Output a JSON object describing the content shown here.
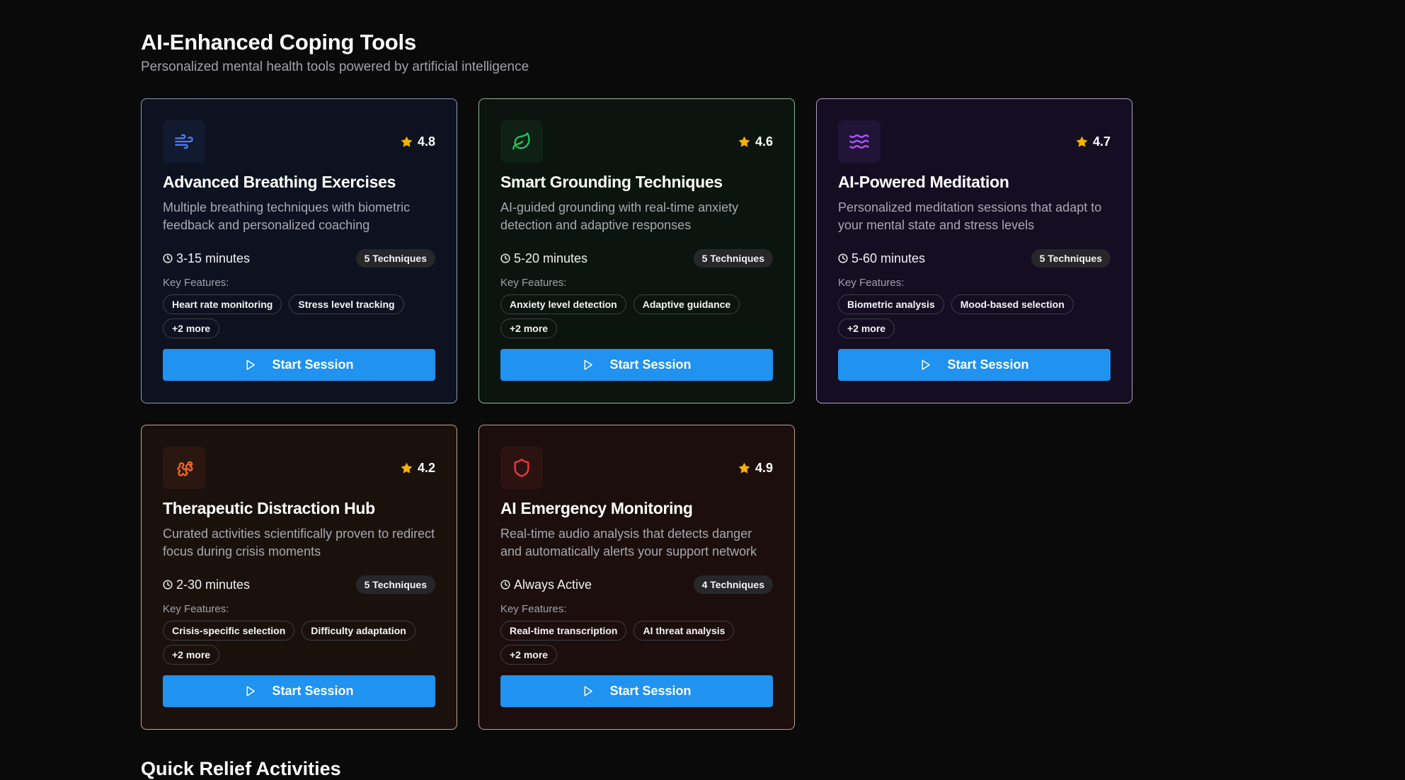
{
  "header": {
    "title": "AI-Enhanced Coping Tools",
    "subtitle": "Personalized mental health tools powered by artificial intelligence"
  },
  "tools": [
    {
      "theme": "blue",
      "icon": "wind-icon",
      "icon_color": "#4f7df0",
      "rating": "4.8",
      "title": "Advanced Breathing Exercises",
      "description": "Multiple breathing techniques with biometric feedback and personalized coaching",
      "duration": "3-15 minutes",
      "techniques": "5 Techniques",
      "features_label": "Key Features:",
      "features": [
        "Heart rate monitoring",
        "Stress level tracking"
      ],
      "more": "+2 more",
      "button": "Start Session"
    },
    {
      "theme": "green",
      "icon": "leaf-icon",
      "icon_color": "#22c55e",
      "rating": "4.6",
      "title": "Smart Grounding Techniques",
      "description": "AI-guided grounding with real-time anxiety detection and adaptive responses",
      "duration": "5-20 minutes",
      "techniques": "5 Techniques",
      "features_label": "Key Features:",
      "features": [
        "Anxiety level detection",
        "Adaptive guidance"
      ],
      "more": "+2 more",
      "button": "Start Session"
    },
    {
      "theme": "purple",
      "icon": "waves-icon",
      "icon_color": "#a855f7",
      "rating": "4.7",
      "title": "AI-Powered Meditation",
      "description": "Personalized meditation sessions that adapt to your mental state and stress levels",
      "duration": "5-60 minutes",
      "techniques": "5 Techniques",
      "features_label": "Key Features:",
      "features": [
        "Biometric analysis",
        "Mood-based selection"
      ],
      "more": "+2 more",
      "button": "Start Session"
    },
    {
      "theme": "orange",
      "icon": "puzzle-icon",
      "icon_color": "#f0642a",
      "rating": "4.2",
      "title": "Therapeutic Distraction Hub",
      "description": "Curated activities scientifically proven to redirect focus during crisis moments",
      "duration": "2-30 minutes",
      "techniques": "5 Techniques",
      "features_label": "Key Features:",
      "features": [
        "Crisis-specific selection",
        "Difficulty adaptation"
      ],
      "more": "+2 more",
      "button": "Start Session"
    },
    {
      "theme": "red",
      "icon": "shield-icon",
      "icon_color": "#ef3b3b",
      "rating": "4.9",
      "title": "AI Emergency Monitoring",
      "description": "Real-time audio analysis that detects danger and automatically alerts your support network",
      "duration": "Always Active",
      "techniques": "4 Techniques",
      "features_label": "Key Features:",
      "features": [
        "Real-time transcription",
        "AI threat analysis"
      ],
      "more": "+2 more",
      "button": "Start Session"
    }
  ],
  "next_section": {
    "title": "Quick Relief Activities"
  },
  "colors": {
    "background": "#0a0a0b",
    "button": "#2092f0",
    "star": "#f5b301"
  }
}
